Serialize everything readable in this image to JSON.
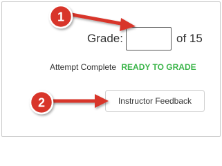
{
  "grade": {
    "label": "Grade:",
    "value": "",
    "total_text": "of 15"
  },
  "attempt": {
    "status_text": "Attempt Complete",
    "badge": "READY TO GRADE"
  },
  "feedback_button": {
    "label": "Instructor Feedback"
  },
  "callouts": [
    {
      "number": "1"
    },
    {
      "number": "2"
    }
  ],
  "colors": {
    "callout_red": "#d8342a",
    "ready_green": "#3bb54a"
  }
}
